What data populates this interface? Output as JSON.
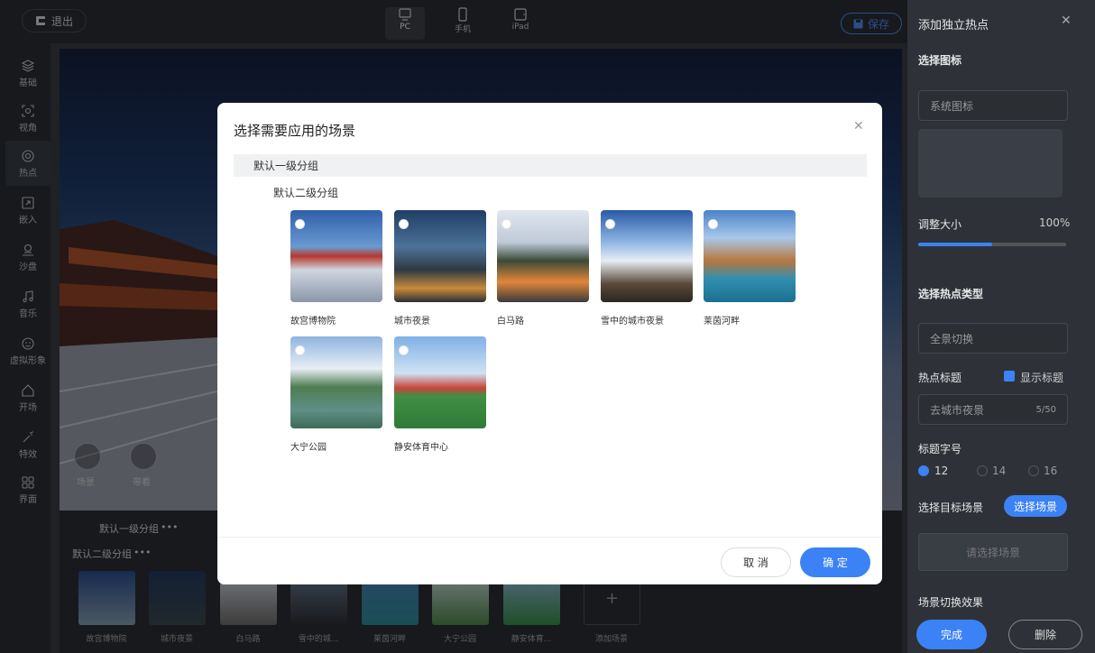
{
  "topbar": {
    "exit_label": "退出",
    "devices": [
      {
        "label": "PC"
      },
      {
        "label": "手机"
      },
      {
        "label": "iPad"
      }
    ],
    "save_label": "保存"
  },
  "leftnav": {
    "items": [
      {
        "label": "基础",
        "icon": "layers-icon"
      },
      {
        "label": "视角",
        "icon": "view-icon"
      },
      {
        "label": "热点",
        "icon": "hotspot-icon"
      },
      {
        "label": "嵌入",
        "icon": "embed-icon"
      },
      {
        "label": "沙盘",
        "icon": "sandbox-icon"
      },
      {
        "label": "音乐",
        "icon": "music-icon"
      },
      {
        "label": "虚拟形象",
        "icon": "avatar-icon"
      },
      {
        "label": "开场",
        "icon": "opening-icon"
      },
      {
        "label": "特效",
        "icon": "effects-icon"
      },
      {
        "label": "界面",
        "icon": "interface-icon"
      }
    ]
  },
  "scene_tools": {
    "scene_label": "场景",
    "guide_label": "带看"
  },
  "bottombar": {
    "group1": "默认一级分组",
    "group2": "默认二级分组",
    "more": "•••",
    "add_scene_label": "添加场景",
    "thumbnails": [
      "故宫博物院",
      "城市夜景",
      "白马路",
      "雪中的城...",
      "莱茵河畔",
      "大宁公园",
      "静安体育..."
    ]
  },
  "rightpanel": {
    "title": "添加独立热点",
    "select_icon": "选择图标",
    "icon_source": "系统图标",
    "resize_label": "调整大小",
    "resize_value": "100%",
    "resize_fraction": 0.5,
    "hotspot_type_label": "选择热点类型",
    "hotspot_type": "全景切换",
    "hotspot_title_label": "热点标题",
    "show_title_label": "显示标题",
    "title_value": "去城市夜景",
    "title_count": "5/50",
    "font_size_label": "标题字号",
    "font_sizes": [
      "12",
      "14",
      "16"
    ],
    "target_scene_label": "选择目标场景",
    "choose_scene_btn": "选择场景",
    "select_scene_placeholder": "请选择场景",
    "transition_label": "场景切换效果",
    "done_btn": "完成",
    "delete_btn": "删除"
  },
  "dialog": {
    "title": "选择需要应用的场景",
    "group1": "默认一级分组",
    "group2": "默认二级分组",
    "scenes": [
      "故宫博物院",
      "城市夜景",
      "白马路",
      "雪中的城市夜景",
      "莱茵河畔",
      "大宁公园",
      "静安体育中心"
    ],
    "cancel": "取 消",
    "confirm": "确 定"
  },
  "colors": {
    "accent": "#3b82f6",
    "panel": "#2e3238",
    "topbar": "#2b2e33"
  }
}
